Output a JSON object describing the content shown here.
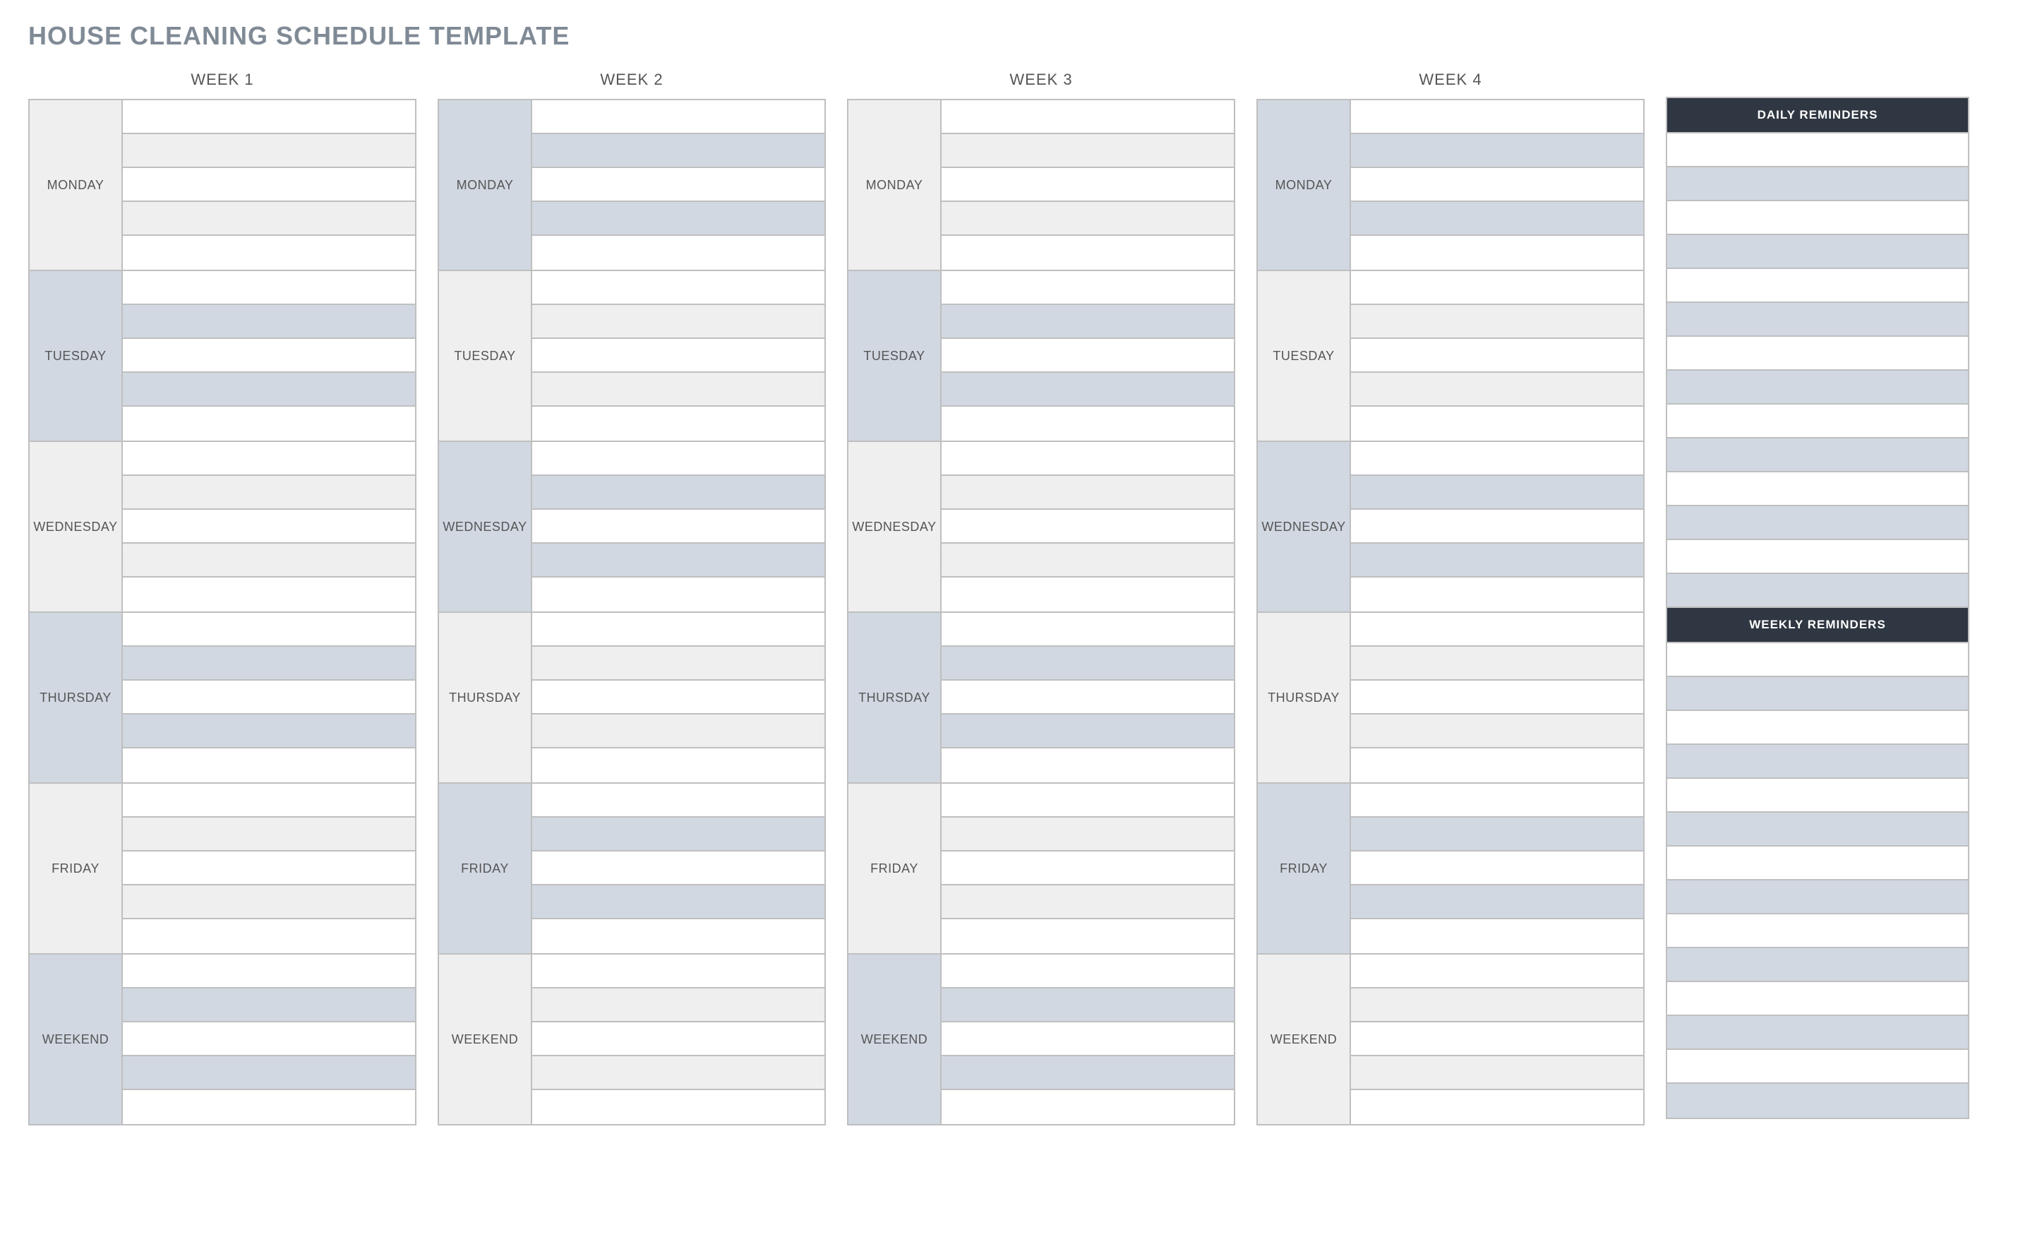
{
  "title": "HOUSE CLEANING SCHEDULE TEMPLATE",
  "weeks": [
    "WEEK 1",
    "WEEK 2",
    "WEEK 3",
    "WEEK 4"
  ],
  "days": [
    "MONDAY",
    "TUESDAY",
    "WEDNESDAY",
    "THURSDAY",
    "FRIDAY",
    "WEEKEND"
  ],
  "tasks_per_day": 5,
  "sidebar": {
    "daily_header": "DAILY REMINDERS",
    "daily_rows": 14,
    "weekly_header": "WEEKLY REMINDERS",
    "weekly_rows": 14
  },
  "colors": {
    "accent_grey": "#efefef",
    "accent_blue": "#d1d8e2",
    "header_dark": "#2f3742"
  }
}
